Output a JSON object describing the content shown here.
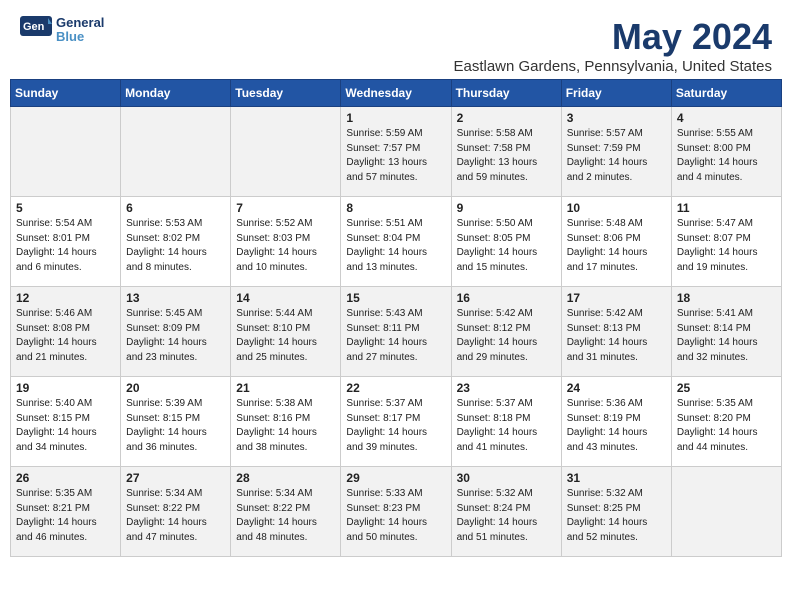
{
  "header": {
    "logo_line1": "General",
    "logo_line2": "Blue",
    "month": "May 2024",
    "location": "Eastlawn Gardens, Pennsylvania, United States"
  },
  "days_of_week": [
    "Sunday",
    "Monday",
    "Tuesday",
    "Wednesday",
    "Thursday",
    "Friday",
    "Saturday"
  ],
  "weeks": [
    [
      {
        "day": "",
        "info": ""
      },
      {
        "day": "",
        "info": ""
      },
      {
        "day": "",
        "info": ""
      },
      {
        "day": "1",
        "info": "Sunrise: 5:59 AM\nSunset: 7:57 PM\nDaylight: 13 hours\nand 57 minutes."
      },
      {
        "day": "2",
        "info": "Sunrise: 5:58 AM\nSunset: 7:58 PM\nDaylight: 13 hours\nand 59 minutes."
      },
      {
        "day": "3",
        "info": "Sunrise: 5:57 AM\nSunset: 7:59 PM\nDaylight: 14 hours\nand 2 minutes."
      },
      {
        "day": "4",
        "info": "Sunrise: 5:55 AM\nSunset: 8:00 PM\nDaylight: 14 hours\nand 4 minutes."
      }
    ],
    [
      {
        "day": "5",
        "info": "Sunrise: 5:54 AM\nSunset: 8:01 PM\nDaylight: 14 hours\nand 6 minutes."
      },
      {
        "day": "6",
        "info": "Sunrise: 5:53 AM\nSunset: 8:02 PM\nDaylight: 14 hours\nand 8 minutes."
      },
      {
        "day": "7",
        "info": "Sunrise: 5:52 AM\nSunset: 8:03 PM\nDaylight: 14 hours\nand 10 minutes."
      },
      {
        "day": "8",
        "info": "Sunrise: 5:51 AM\nSunset: 8:04 PM\nDaylight: 14 hours\nand 13 minutes."
      },
      {
        "day": "9",
        "info": "Sunrise: 5:50 AM\nSunset: 8:05 PM\nDaylight: 14 hours\nand 15 minutes."
      },
      {
        "day": "10",
        "info": "Sunrise: 5:48 AM\nSunset: 8:06 PM\nDaylight: 14 hours\nand 17 minutes."
      },
      {
        "day": "11",
        "info": "Sunrise: 5:47 AM\nSunset: 8:07 PM\nDaylight: 14 hours\nand 19 minutes."
      }
    ],
    [
      {
        "day": "12",
        "info": "Sunrise: 5:46 AM\nSunset: 8:08 PM\nDaylight: 14 hours\nand 21 minutes."
      },
      {
        "day": "13",
        "info": "Sunrise: 5:45 AM\nSunset: 8:09 PM\nDaylight: 14 hours\nand 23 minutes."
      },
      {
        "day": "14",
        "info": "Sunrise: 5:44 AM\nSunset: 8:10 PM\nDaylight: 14 hours\nand 25 minutes."
      },
      {
        "day": "15",
        "info": "Sunrise: 5:43 AM\nSunset: 8:11 PM\nDaylight: 14 hours\nand 27 minutes."
      },
      {
        "day": "16",
        "info": "Sunrise: 5:42 AM\nSunset: 8:12 PM\nDaylight: 14 hours\nand 29 minutes."
      },
      {
        "day": "17",
        "info": "Sunrise: 5:42 AM\nSunset: 8:13 PM\nDaylight: 14 hours\nand 31 minutes."
      },
      {
        "day": "18",
        "info": "Sunrise: 5:41 AM\nSunset: 8:14 PM\nDaylight: 14 hours\nand 32 minutes."
      }
    ],
    [
      {
        "day": "19",
        "info": "Sunrise: 5:40 AM\nSunset: 8:15 PM\nDaylight: 14 hours\nand 34 minutes."
      },
      {
        "day": "20",
        "info": "Sunrise: 5:39 AM\nSunset: 8:15 PM\nDaylight: 14 hours\nand 36 minutes."
      },
      {
        "day": "21",
        "info": "Sunrise: 5:38 AM\nSunset: 8:16 PM\nDaylight: 14 hours\nand 38 minutes."
      },
      {
        "day": "22",
        "info": "Sunrise: 5:37 AM\nSunset: 8:17 PM\nDaylight: 14 hours\nand 39 minutes."
      },
      {
        "day": "23",
        "info": "Sunrise: 5:37 AM\nSunset: 8:18 PM\nDaylight: 14 hours\nand 41 minutes."
      },
      {
        "day": "24",
        "info": "Sunrise: 5:36 AM\nSunset: 8:19 PM\nDaylight: 14 hours\nand 43 minutes."
      },
      {
        "day": "25",
        "info": "Sunrise: 5:35 AM\nSunset: 8:20 PM\nDaylight: 14 hours\nand 44 minutes."
      }
    ],
    [
      {
        "day": "26",
        "info": "Sunrise: 5:35 AM\nSunset: 8:21 PM\nDaylight: 14 hours\nand 46 minutes."
      },
      {
        "day": "27",
        "info": "Sunrise: 5:34 AM\nSunset: 8:22 PM\nDaylight: 14 hours\nand 47 minutes."
      },
      {
        "day": "28",
        "info": "Sunrise: 5:34 AM\nSunset: 8:22 PM\nDaylight: 14 hours\nand 48 minutes."
      },
      {
        "day": "29",
        "info": "Sunrise: 5:33 AM\nSunset: 8:23 PM\nDaylight: 14 hours\nand 50 minutes."
      },
      {
        "day": "30",
        "info": "Sunrise: 5:32 AM\nSunset: 8:24 PM\nDaylight: 14 hours\nand 51 minutes."
      },
      {
        "day": "31",
        "info": "Sunrise: 5:32 AM\nSunset: 8:25 PM\nDaylight: 14 hours\nand 52 minutes."
      },
      {
        "day": "",
        "info": ""
      }
    ]
  ]
}
